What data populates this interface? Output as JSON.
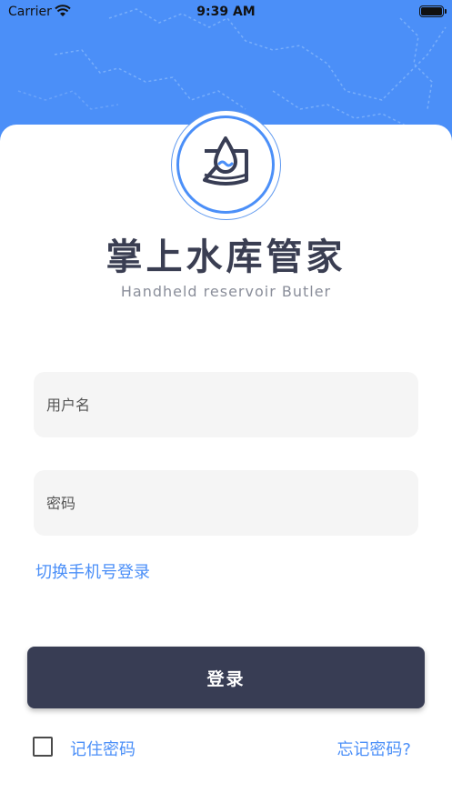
{
  "status_bar": {
    "carrier": "Carrier",
    "time": "9:39 AM"
  },
  "app": {
    "title": "掌上水库管家",
    "subtitle": "Handheld reservoir Butler"
  },
  "form": {
    "username_placeholder": "用户名",
    "password_placeholder": "密码",
    "switch_login_label": "切换手机号登录",
    "login_button_label": "登录",
    "remember_label": "记住密码",
    "forgot_label": "忘记密码?"
  },
  "colors": {
    "brand_blue": "#4b8ff8",
    "button_dark": "#383d54",
    "field_bg": "#f5f5f5"
  }
}
